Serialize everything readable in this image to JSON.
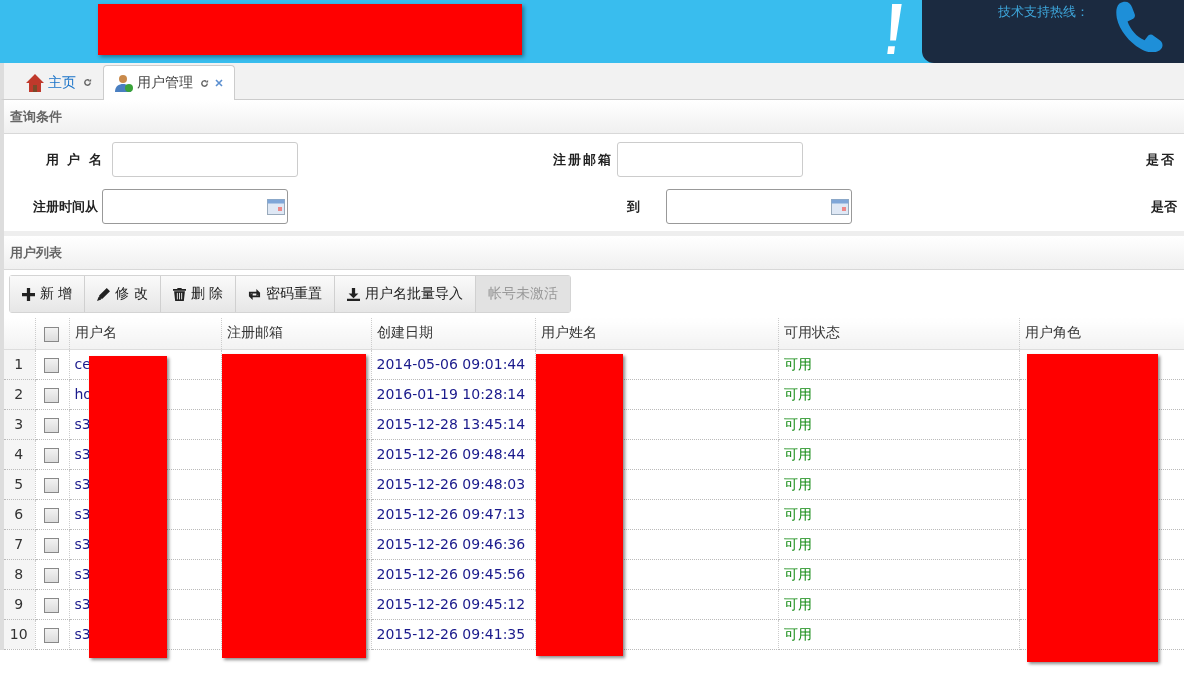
{
  "header": {
    "hotline_label": "技术支持热线："
  },
  "tabs": [
    {
      "label": "主页",
      "selected": false,
      "closable": false
    },
    {
      "label": "用户管理",
      "selected": true,
      "closable": true
    }
  ],
  "query": {
    "title": "查询条件",
    "rows": [
      [
        {
          "label": "用 户 名",
          "kind": "text"
        },
        {
          "label": "注册邮箱",
          "kind": "text"
        },
        {
          "label": "是否",
          "kind": "cut"
        }
      ],
      [
        {
          "label": "注册时间从",
          "kind": "date"
        },
        {
          "label": "到",
          "kind": "date"
        },
        {
          "label": "是否",
          "kind": "cut"
        }
      ]
    ]
  },
  "list": {
    "title": "用户列表",
    "toolbar": [
      {
        "label": "新 增",
        "disabled": false
      },
      {
        "label": "修 改",
        "disabled": false
      },
      {
        "label": "删 除",
        "disabled": false
      },
      {
        "label": "密码重置",
        "disabled": false
      },
      {
        "label": "用户名批量导入",
        "disabled": false
      },
      {
        "label": "帐号未激活",
        "disabled": true
      }
    ],
    "select_all_checked": false,
    "columns": [
      "用户名",
      "注册邮箱",
      "创建日期",
      "用户姓名",
      "可用状态",
      "用户角色"
    ],
    "rows": [
      {
        "index": "1",
        "checked": false,
        "username": "ce",
        "created": "2014-05-06 09:01:44",
        "status": "可用"
      },
      {
        "index": "2",
        "checked": false,
        "username": "ho",
        "created": "2016-01-19 10:28:14",
        "status": "可用"
      },
      {
        "index": "3",
        "checked": false,
        "username": "s3",
        "created": "2015-12-28 13:45:14",
        "status": "可用"
      },
      {
        "index": "4",
        "checked": false,
        "username": "s3",
        "created": "2015-12-26 09:48:44",
        "status": "可用"
      },
      {
        "index": "5",
        "checked": false,
        "username": "s3",
        "created": "2015-12-26 09:48:03",
        "status": "可用"
      },
      {
        "index": "6",
        "checked": false,
        "username": "s3",
        "created": "2015-12-26 09:47:13",
        "status": "可用"
      },
      {
        "index": "7",
        "checked": false,
        "username": "s3",
        "created": "2015-12-26 09:46:36",
        "status": "可用"
      },
      {
        "index": "8",
        "checked": false,
        "username": "s3",
        "created": "2015-12-26 09:45:56",
        "status": "可用"
      },
      {
        "index": "9",
        "checked": false,
        "username": "s3",
        "created": "2015-12-26 09:45:12",
        "status": "可用"
      },
      {
        "index": "10",
        "checked": false,
        "username": "s3",
        "created": "2015-12-26 09:41:35",
        "status": "可用"
      }
    ]
  }
}
